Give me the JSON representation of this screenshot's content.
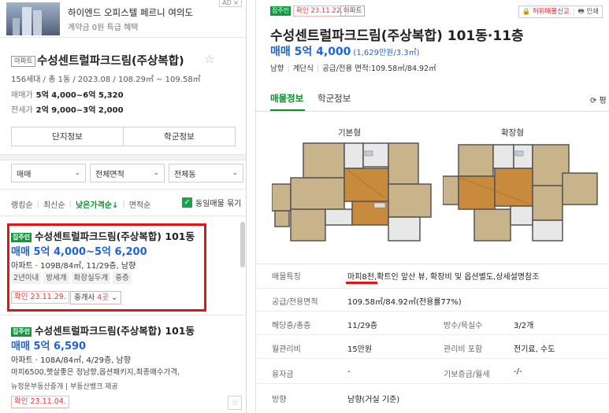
{
  "ad": {
    "title": "하이엔드 오피스텔 페르니 여의도",
    "subtitle": "계약금 0원 특급 혜택",
    "badge": "AD ×"
  },
  "complex": {
    "type_tag": "아파트",
    "name": "수성센트럴파크드림(주상복합)",
    "star": "☆",
    "summary": "156세대 / 총 1동 / 2023.08 / 108.29㎡ ~ 109.58㎡",
    "sale_label": "매매가",
    "sale_value": "5억 4,000~6억 5,320",
    "jeonse_label": "전세가",
    "jeonse_value": "2억 9,000~3억 2,000",
    "btn_info": "단지정보",
    "btn_school": "학군정보"
  },
  "filters": [
    {
      "label": "매매",
      "chev": "⌄"
    },
    {
      "label": "전체면적",
      "chev": "⌄"
    },
    {
      "label": "전체동",
      "chev": "⌄"
    }
  ],
  "sort": {
    "ranking": "랭킹순",
    "latest": "최신순",
    "low_price": "낮은가격순↓",
    "area": "면적순",
    "same_label": "동일매물 묶기",
    "check": "✓"
  },
  "listings": [
    {
      "tag": "집주인",
      "title": "수성센트럴파크드림(주상복합) 101동",
      "price": "매매 5억 4,000~5억 6,200",
      "spec": "아파트 · 109B/84㎡, 11/29층, 남향",
      "tags": [
        "2년이내",
        "방세개",
        "화장실두개",
        "중층"
      ],
      "confirmed": "확인 23.11.29.",
      "agent_label": "중개사",
      "agent_count": "4곳",
      "agent_chev": "⌄"
    },
    {
      "tag": "집주인",
      "title": "수성센트럴파크드림(주상복합) 101동",
      "price": "매매 5억 6,590",
      "spec": "아파트 · 108A/84㎡, 4/29층, 남향",
      "desc": "마피6500,햇살좋은 정남향,옵션패키지,최종매수가격,",
      "desc2": "뉴정운부동산중개 | 부동산뱅크 제공",
      "confirmed": "확인 23.11.04.",
      "star": "☆"
    }
  ],
  "detail": {
    "tag": "집주인",
    "confirmed": "확인 23.11.22.",
    "type_tag": "아파트",
    "report": "🔒 허위매물신고",
    "print": "🖶 인쇄",
    "star": "☆",
    "title": "수성센트럴파크드림(주상복합) 101동·11층",
    "price": "매매 5억 4,000",
    "price_sub": "(1,629만원/3.3㎡)",
    "summary": [
      "남향",
      "계단식",
      "공급/전용 면적:109.58㎡/84.92㎡"
    ],
    "tabs": {
      "listing": "매물정보",
      "school": "학군정보",
      "review": "⟳ 평"
    },
    "floorplans": {
      "basic": "기본형",
      "extended": "확장형"
    }
  },
  "table": [
    {
      "label": "매물특징",
      "value": "마피8천,확트인 앞산 뷰, 확장비 및 옵션별도,상세설명참조"
    },
    {
      "label": "공급/전용면적",
      "value": "109.58㎡/84.92㎡(전용률77%)"
    },
    {
      "label": "해당층/총층",
      "value": "11/29층",
      "label2": "방수/욕실수",
      "value2": "3/2개"
    },
    {
      "label": "월관리비",
      "value": "15만원",
      "label2": "관리비 포함",
      "value2": "전기료, 수도"
    },
    {
      "label": "융자금",
      "value": "-",
      "label2": "기보증금/월세",
      "value2": "-/-"
    },
    {
      "label": "방향",
      "value": "남향(거실 기준)"
    }
  ],
  "colors": {
    "accent_green": "#0a8f2f",
    "price_blue": "#1e64d6",
    "highlight_red": "#e01616"
  }
}
